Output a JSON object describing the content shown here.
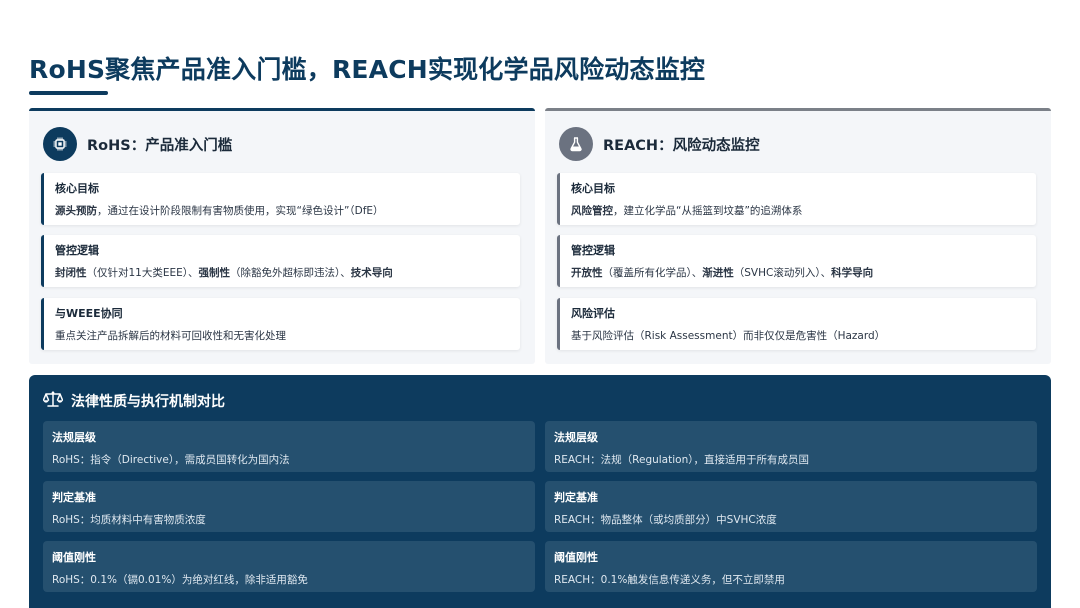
{
  "header": {
    "title": "RoHS聚焦产品准入门槛，REACH实现化学品风险动态监控"
  },
  "rohs": {
    "icon": "chip-icon",
    "title": "RoHS：产品准入门槛",
    "cards": [
      {
        "label": "核心目标",
        "parts": [
          {
            "text": "源头预防",
            "bold": true
          },
          {
            "text": "，通过在设计阶段限制有害物质使用，实现“绿色设计”（DfE）",
            "bold": false
          }
        ]
      },
      {
        "label": "管控逻辑",
        "parts": [
          {
            "text": "封闭性",
            "bold": true
          },
          {
            "text": "（仅针对11大类EEE）、",
            "bold": false
          },
          {
            "text": "强制性",
            "bold": true
          },
          {
            "text": "（除豁免外超标即违法）、",
            "bold": false
          },
          {
            "text": "技术导向",
            "bold": true
          }
        ]
      },
      {
        "label": "与WEEE协同",
        "parts": [
          {
            "text": "重点关注产品拆解后的材料可回收性和无害化处理",
            "bold": false
          }
        ]
      }
    ]
  },
  "reach": {
    "icon": "flask-icon",
    "title": "REACH：风险动态监控",
    "cards": [
      {
        "label": "核心目标",
        "parts": [
          {
            "text": "风险管控",
            "bold": true
          },
          {
            "text": "，建立化学品“从摇篮到坟墓”的追溯体系",
            "bold": false
          }
        ]
      },
      {
        "label": "管控逻辑",
        "parts": [
          {
            "text": "开放性",
            "bold": true
          },
          {
            "text": "（覆盖所有化学品）、",
            "bold": false
          },
          {
            "text": "渐进性",
            "bold": true
          },
          {
            "text": "（SVHC滚动列入）、",
            "bold": false
          },
          {
            "text": "科学导向",
            "bold": true
          }
        ]
      },
      {
        "label": "风险评估",
        "parts": [
          {
            "text": "基于风险评估（Risk Assessment）而非仅仅是危害性（Hazard）",
            "bold": false
          }
        ]
      }
    ]
  },
  "comparison": {
    "icon": "scale-icon",
    "title": "法律性质与执行机制对比",
    "rows": [
      {
        "left": {
          "label": "法规层级",
          "text": "RoHS：指令（Directive），需成员国转化为国内法"
        },
        "right": {
          "label": "法规层级",
          "text": "REACH：法规（Regulation），直接适用于所有成员国"
        }
      },
      {
        "left": {
          "label": "判定基准",
          "text": "RoHS：均质材料中有害物质浓度"
        },
        "right": {
          "label": "判定基准",
          "text": "REACH：物品整体（或均质部分）中SVHC浓度"
        }
      },
      {
        "left": {
          "label": "阈值刚性",
          "text": "RoHS：0.1%（镉0.01%）为绝对红线，除非适用豁免"
        },
        "right": {
          "label": "阈值刚性",
          "text": "REACH：0.1%触发信息传递义务，但不立即禁用"
        }
      }
    ]
  },
  "colors": {
    "primary": "#0d3b5e",
    "secondary": "#6b7280",
    "panel_bg": "#f4f6f9",
    "cell_bg": "#25506f"
  }
}
